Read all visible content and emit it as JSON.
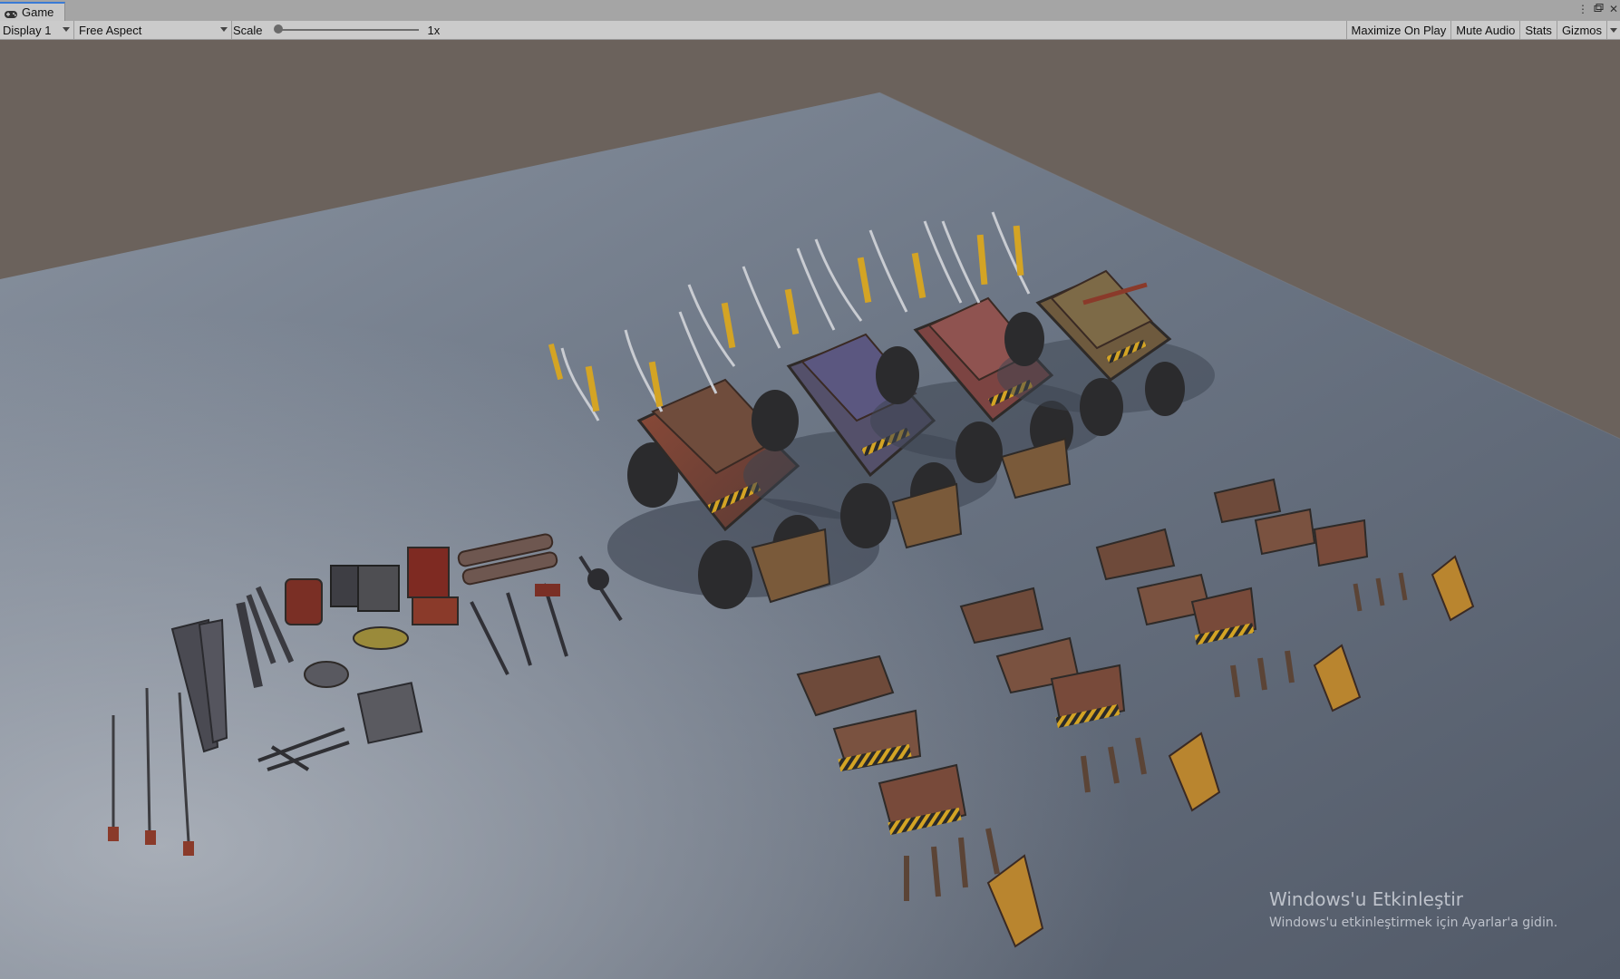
{
  "tab": {
    "label": "Game",
    "icon": "gamepad-icon"
  },
  "window_controls": [
    "kebab-menu-icon",
    "maximize-icon",
    "close-icon"
  ],
  "toolbar": {
    "display": "Display 1",
    "aspect": "Free Aspect",
    "scale_label": "Scale",
    "scale_value": "1x",
    "scale_level": 0.0,
    "buttons": {
      "maximize": "Maximize On Play",
      "mute": "Mute Audio",
      "stats": "Stats",
      "gizmos": "Gizmos"
    }
  },
  "colors": {
    "sky": "#6b625c",
    "ground": "#6f7a88",
    "rust": "#8a3a2a",
    "hazard": "#d4a424"
  },
  "watermark": {
    "title": "Windows'u Etkinleştir",
    "subtitle": "Windows'u etkinleştirmek için Ayarlar'a gidin."
  }
}
